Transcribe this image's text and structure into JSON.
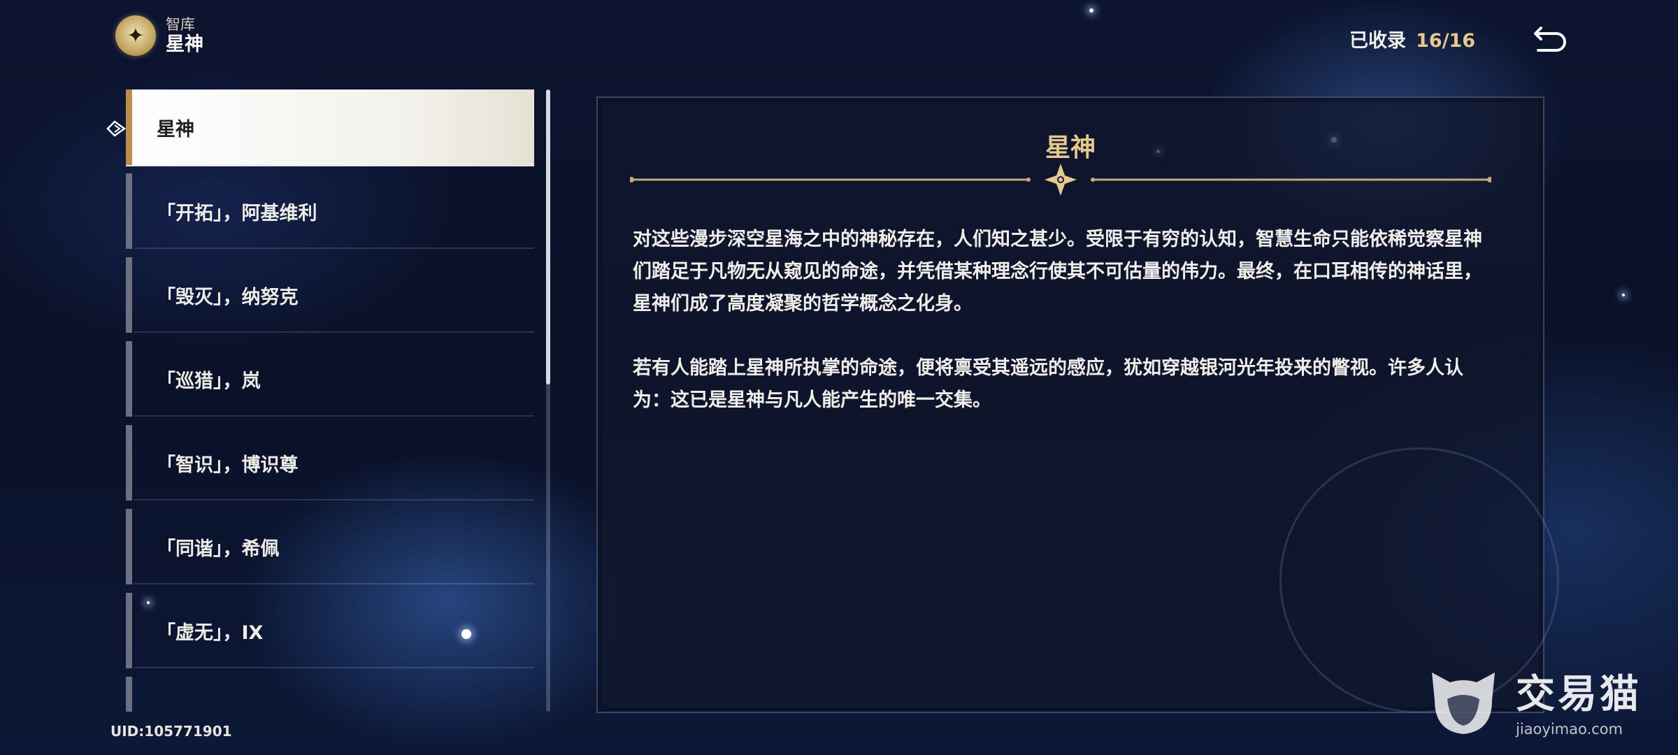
{
  "header": {
    "section": "智库",
    "title": "星神"
  },
  "collection": {
    "label": "已收录",
    "count": "16/16"
  },
  "list": {
    "items": [
      {
        "label": "星神",
        "selected": true
      },
      {
        "label": "「开拓」，阿基维利",
        "selected": false
      },
      {
        "label": "「毁灭」，纳努克",
        "selected": false
      },
      {
        "label": "「巡猎」，岚",
        "selected": false
      },
      {
        "label": "「智识」，博识尊",
        "selected": false
      },
      {
        "label": "「同谐」，希佩",
        "selected": false
      },
      {
        "label": "「虚无」，IX",
        "selected": false
      },
      {
        "label": "",
        "selected": false
      }
    ]
  },
  "content": {
    "title": "星神",
    "paragraphs": [
      "对这些漫步深空星海之中的神秘存在，人们知之甚少。受限于有穷的认知，智慧生命只能依稀觉察星神们踏足于凡物无从窥见的命途，并凭借某种理念行使其不可估量的伟力。最终，在口耳相传的神话里，星神们成了高度凝聚的哲学概念之化身。",
      "若有人能踏上星神所执掌的命途，便将禀受其遥远的感应，犹如穿越银河光年投来的瞥视。许多人认为：这已是星神与凡人能产生的唯一交集。"
    ]
  },
  "footer": {
    "uid": "UID:105771901"
  },
  "watermark": {
    "cn": "交易猫",
    "en": "jiaoyimao.com"
  },
  "colors": {
    "accent_gold": "#e6c98e",
    "selected_bar": "#b98f4e",
    "panel_bg": "#10162c"
  }
}
